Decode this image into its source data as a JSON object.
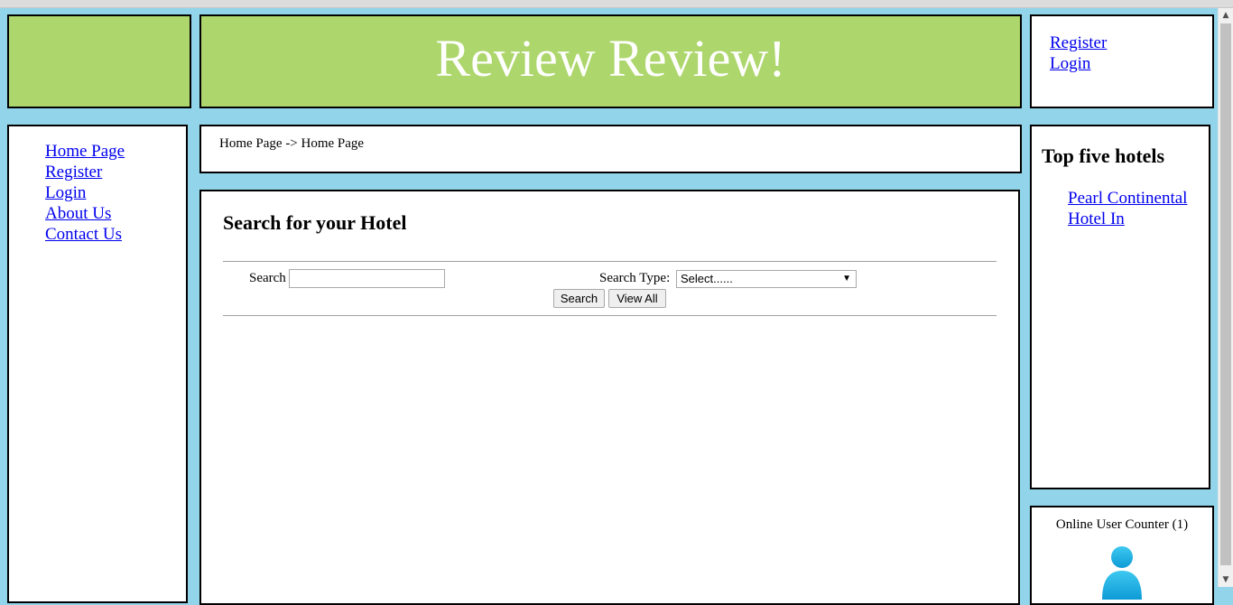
{
  "header": {
    "site_title": "Review Review!",
    "auth_links": [
      "Register",
      "Login"
    ]
  },
  "sidebar": {
    "items": [
      {
        "label": "Home Page"
      },
      {
        "label": "Register"
      },
      {
        "label": "Login"
      },
      {
        "label": "About Us"
      },
      {
        "label": "Contact Us"
      }
    ]
  },
  "breadcrumb": "Home Page -> Home Page",
  "search": {
    "title": "Search for your Hotel",
    "search_label": "Search",
    "search_value": "",
    "type_label": "Search Type:",
    "type_selected": "Select......",
    "search_button": "Search",
    "view_all_button": "View All"
  },
  "top_hotels": {
    "title": "Top five hotels",
    "items": [
      "Pearl Continental",
      "Hotel In"
    ]
  },
  "counter": {
    "label": "Online User Counter (1)",
    "icon": "user-icon"
  },
  "colors": {
    "page_background": "#92d5ea",
    "header_green": "#add66c",
    "link": "#0000ee"
  }
}
